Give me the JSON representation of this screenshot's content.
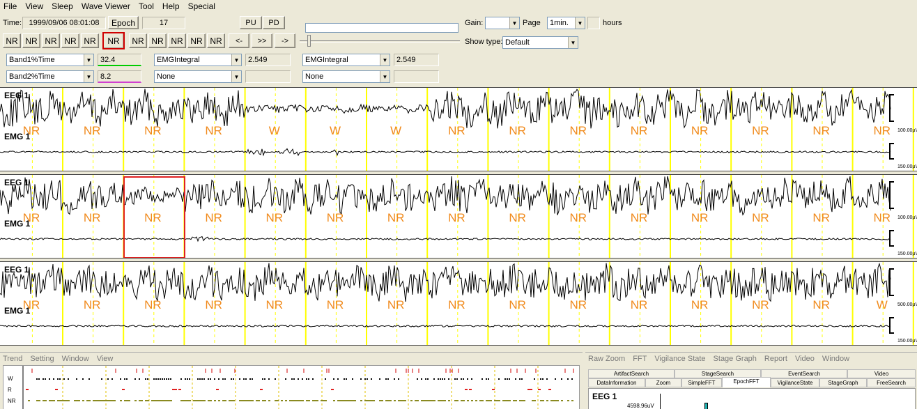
{
  "menu": [
    "File",
    "View",
    "Sleep",
    "Wave Viewer",
    "Tool",
    "Help",
    "Special"
  ],
  "toolbar": {
    "time_label": "Time:",
    "time_value": "1999/09/06 08:01:08",
    "epoch_button": "Epoch",
    "epoch_value": "17",
    "pu": "PU",
    "pd": "PD",
    "gain_label": "Gain:",
    "page_label": "Page",
    "page_value": "1min.",
    "hours_label": "hours",
    "stage_buttons": [
      "NR",
      "NR",
      "NR",
      "NR",
      "NR",
      "NR",
      "NR",
      "NR",
      "NR",
      "NR",
      "NR"
    ],
    "nav_buttons": [
      "<-",
      ">>",
      "->"
    ],
    "showtype_label": "Show type:",
    "showtype_value": "Default"
  },
  "params": {
    "r1": {
      "sel1": "Band1%Time",
      "val1": "32.4",
      "sel2": "EMGIntegral",
      "val2": "2.549",
      "sel3": "EMGIntegral",
      "val3": "2.549"
    },
    "r2": {
      "sel1": "Band2%Time",
      "val1": "8.2",
      "sel2": "None",
      "sel3": "None"
    }
  },
  "colors": {
    "stage": "#f08a1c",
    "yellow": "#ffff00",
    "band1": "#00cc00",
    "band2": "#d040d0"
  },
  "panels": [
    {
      "eeg": "EEG 1",
      "emg": "EMG 1",
      "stages": [
        "NR",
        "NR",
        "NR",
        "NR",
        "W",
        "W",
        "W",
        "NR",
        "NR",
        "NR",
        "NR",
        "NR",
        "NR",
        "NR",
        "NR"
      ],
      "scale1": "100.00µV",
      "scale2": "150.00µV"
    },
    {
      "eeg": "EEG 1",
      "emg": "EMG 1",
      "stages": [
        "NR",
        "NR",
        "NR",
        "NR",
        "NR",
        "NR",
        "NR",
        "NR",
        "NR",
        "NR",
        "NR",
        "NR",
        "NR",
        "NR",
        "NR"
      ],
      "scale1": "100.00µV",
      "scale2": "150.00µV"
    },
    {
      "eeg": "EEG 1",
      "emg": "EMG 1",
      "stages": [
        "NR",
        "NR",
        "NR",
        "NR",
        "NR",
        "NR",
        "NR",
        "NR",
        "NR",
        "NR",
        "NR",
        "NR",
        "NR",
        "NR",
        "W"
      ],
      "scale1": "500.00µV",
      "scale2": "150.00µV"
    }
  ],
  "bottom_left": {
    "tabs": [
      "Trend",
      "Setting",
      "Window",
      "View"
    ],
    "rows": [
      "W",
      "R",
      "NR"
    ]
  },
  "bottom_right": {
    "menu": [
      "Raw Zoom",
      "FFT",
      "Vigilance State",
      "Stage Graph",
      "Report",
      "Video",
      "Window"
    ],
    "tabs_row1": [
      "ArtifactSearch",
      "StageSearch",
      "EventSearch",
      "Video"
    ],
    "tabs_row2": [
      "DataInformation",
      "Zoom",
      "SimpleFFT",
      "EpochFFT",
      "VigilanceState",
      "StageGraph",
      "FreeSearch"
    ],
    "channel": "EEG 1",
    "value": "4598.96uV"
  }
}
